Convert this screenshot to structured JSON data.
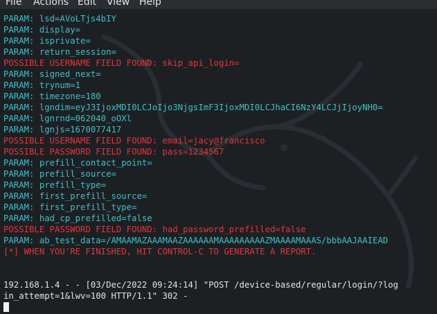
{
  "menubar": {
    "items": [
      {
        "label": "File"
      },
      {
        "label": "Actions"
      },
      {
        "label": "Edit"
      },
      {
        "label": "View"
      },
      {
        "label": "Help"
      }
    ]
  },
  "terminal": {
    "lines": [
      {
        "text": "PARAM: lsd=AVoLTjs4bIY",
        "kind": "param"
      },
      {
        "text": "PARAM: display=",
        "kind": "param"
      },
      {
        "text": "PARAM: isprivate=",
        "kind": "param"
      },
      {
        "text": "PARAM: return_session=",
        "kind": "param"
      },
      {
        "text": "POSSIBLE USERNAME FIELD FOUND: skip_api_login=",
        "kind": "alert"
      },
      {
        "text": "PARAM: signed_next=",
        "kind": "param"
      },
      {
        "text": "PARAM: trynum=1",
        "kind": "param"
      },
      {
        "text": "PARAM: timezone=180",
        "kind": "param"
      },
      {
        "text": "PARAM: lgndim=eyJ3IjoxMDI0LCJoIjo3NjgsImF3IjoxMDI0LCJhaCI6NzY4LCJjIjoyNH0=",
        "kind": "param"
      },
      {
        "text": "PARAM: lgnrnd=062040_oOXl",
        "kind": "param"
      },
      {
        "text": "PARAM: lgnjs=1670077417",
        "kind": "param"
      },
      {
        "text": "POSSIBLE USERNAME FIELD FOUND: email=jacy@francisco",
        "kind": "alert"
      },
      {
        "text": "POSSIBLE PASSWORD FIELD FOUND: pass=1234567",
        "kind": "alert"
      },
      {
        "text": "PARAM: prefill_contact_point=",
        "kind": "param"
      },
      {
        "text": "PARAM: prefill_source=",
        "kind": "param"
      },
      {
        "text": "PARAM: prefill_type=",
        "kind": "param"
      },
      {
        "text": "PARAM: first_prefill_source=",
        "kind": "param"
      },
      {
        "text": "PARAM: first_prefill_type=",
        "kind": "param"
      },
      {
        "text": "PARAM: had_cp_prefilled=false",
        "kind": "param"
      },
      {
        "text": "POSSIBLE PASSWORD FIELD FOUND: had_password_prefilled=false",
        "kind": "alert"
      },
      {
        "text": "PARAM: ab_test_data=/AMAAMAZAAAMAAZAAAAAAMAAAAAAAAAZMAAAAMAAAS/bbbAAJAAIEAD",
        "kind": "param"
      },
      {
        "text": "[*] WHEN YOU'RE FINISHED, HIT CONTROL-C TO GENERATE A REPORT.",
        "kind": "info"
      },
      {
        "text": "",
        "kind": "blank"
      },
      {
        "text": "",
        "kind": "blank"
      },
      {
        "text": "192.168.1.4 - - [03/Dec/2022 09:24:14] \"POST /device-based/regular/login/?log",
        "kind": "log"
      },
      {
        "text": "in_attempt=1&lwv=100 HTTP/1.1\" 302 -",
        "kind": "log"
      }
    ]
  },
  "colors": {
    "param": "#3cc0c8",
    "alert": "#e0363b",
    "log": "#e2e4e6",
    "background": "#1d2023"
  }
}
